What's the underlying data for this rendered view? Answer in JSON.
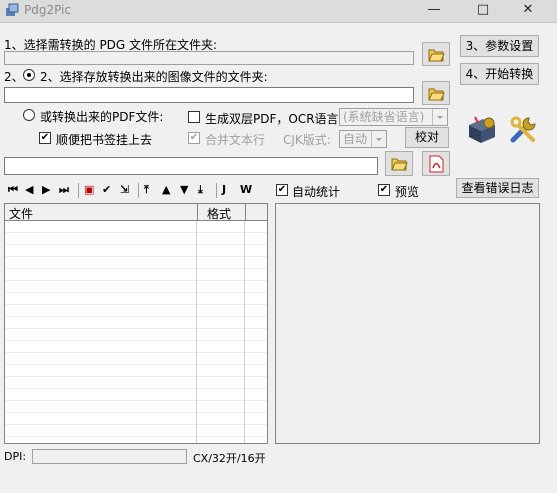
{
  "window": {
    "title": "Pdg2Pic",
    "min": "—",
    "max": "□",
    "close": "✕"
  },
  "section1": {
    "label": "1、选择需转换的 PDG 文件所在文件夹:",
    "path": ""
  },
  "section2": {
    "label": "2、选择存放转换出来的图像文件的文件夹:",
    "path": ""
  },
  "pdf": {
    "label": "或转换出来的PDF文件:",
    "bookmark_label": "顺便把书签挂上去",
    "dual_layer_label": "生成双层PDF，OCR语言:",
    "ocr_language": "(系统缺省语言)",
    "merge_lines_label": "合并文本行",
    "cjk_label": "CJK版式:",
    "cjk_value": "自动",
    "proofread_button": "校对",
    "path": ""
  },
  "buttons": {
    "settings": "3、参数设置",
    "start": "4、开始转换",
    "error_log": "查看错误日志"
  },
  "toolbar": {
    "icons": [
      "first-page-icon",
      "prev-page-icon",
      "next-page-icon",
      "last-page-icon",
      "red-page-icon",
      "check-icon",
      "export-icon",
      "move-top-icon",
      "move-up-icon",
      "move-down-icon",
      "move-bottom-icon",
      "text-j-icon",
      "text-w-icon"
    ],
    "glyphs": [
      "⏮",
      "◀",
      "▶",
      "⏭",
      "▣",
      "✔",
      "⇲",
      "⤒",
      "▲",
      "▼",
      "⤓",
      "J",
      "W"
    ]
  },
  "options": {
    "auto_stats": "自动统计",
    "preview": "预览"
  },
  "table": {
    "col_file": "文件",
    "col_format": "格式"
  },
  "status": {
    "dpi_label": "DPI:",
    "size_info": "CX/32开/16开"
  }
}
